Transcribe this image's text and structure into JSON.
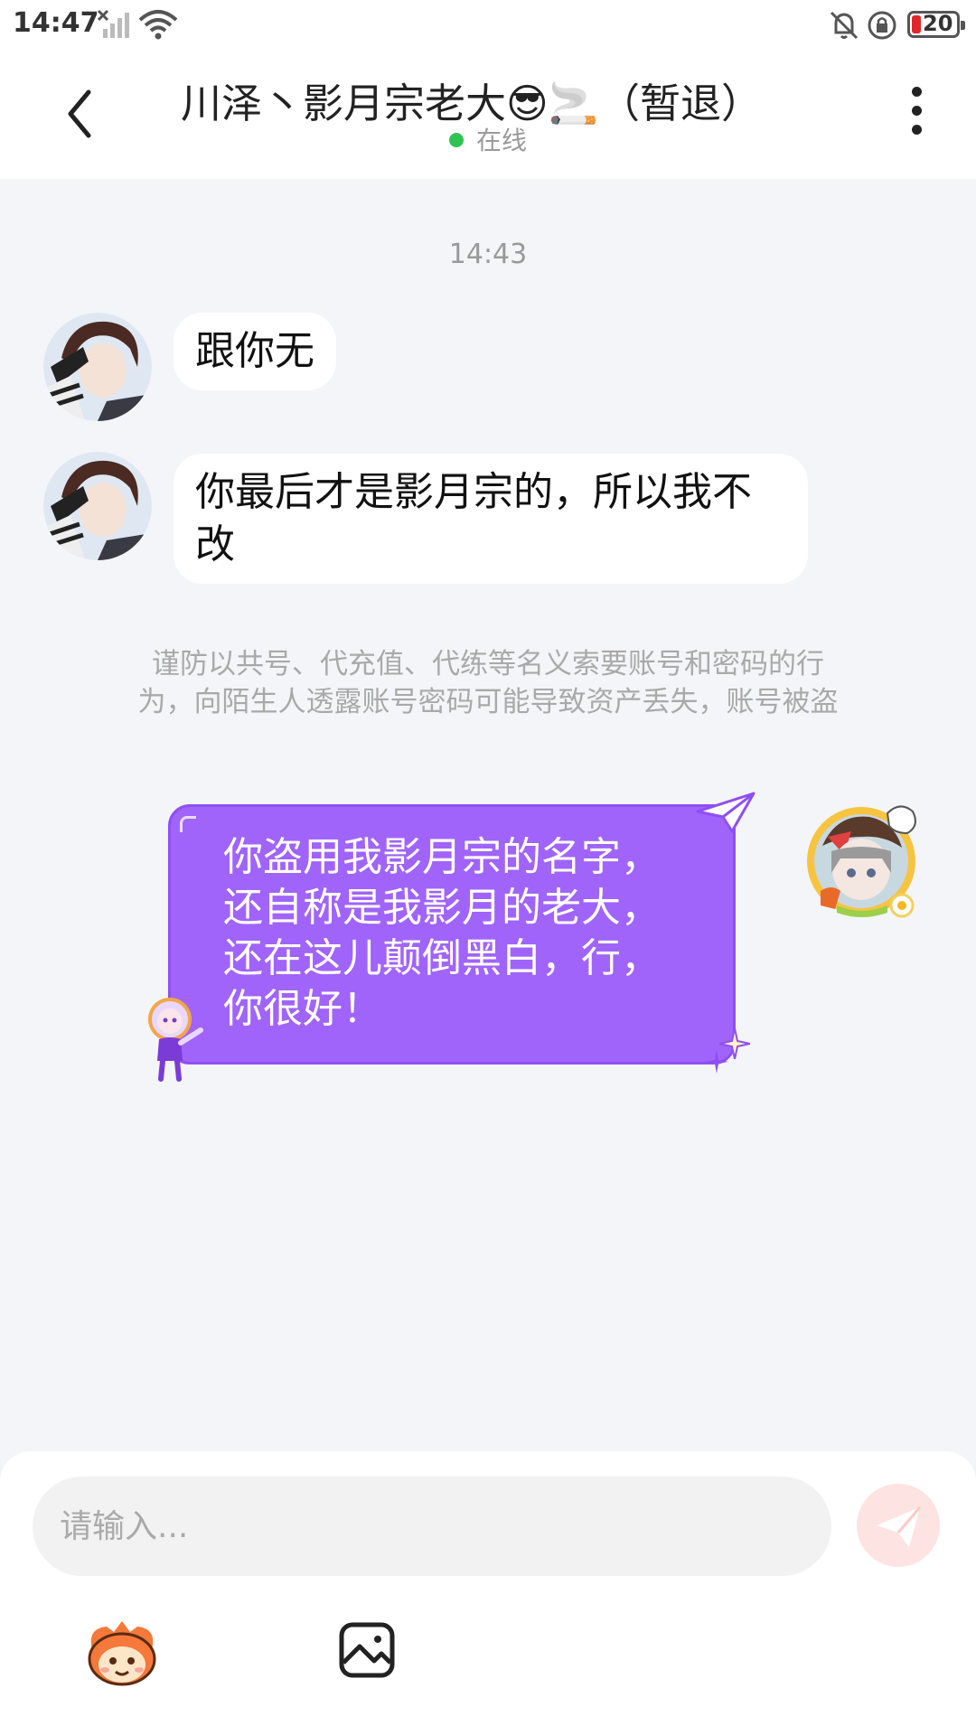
{
  "status_bar": {
    "time": "14:47",
    "battery": "20",
    "icons": [
      "no-sim-signal-icon",
      "wifi-icon",
      "mute-bell-icon",
      "rotation-lock-icon",
      "battery-icon"
    ]
  },
  "header": {
    "title": "川泽丶影月宗老大😎🚬（暂退）",
    "status": "在线",
    "status_color": "#2fc452"
  },
  "messages": {
    "timestamp": "14:43",
    "incoming": [
      {
        "text": "跟你无"
      },
      {
        "text_line1": "你最后才是影月宗的，所以我不",
        "text_line2": "改"
      }
    ],
    "notice_line1": "谨防以共号、代充值、代练等名义索要账号和密码的行",
    "notice_line2": "为，向陌生人透露账号密码可能导致资产丢失，账号被盗",
    "outgoing": {
      "lines": [
        "你盗用我影月宗的名字，",
        "还自称是我影月的老大，",
        "还在这儿颠倒黑白，行，",
        "你很好！"
      ],
      "bubble_color": "#a064fa"
    }
  },
  "composer": {
    "placeholder": "请输入...",
    "send_color": "#fde3e2",
    "tools": [
      "emoji-mascot-icon",
      "image-icon"
    ]
  }
}
